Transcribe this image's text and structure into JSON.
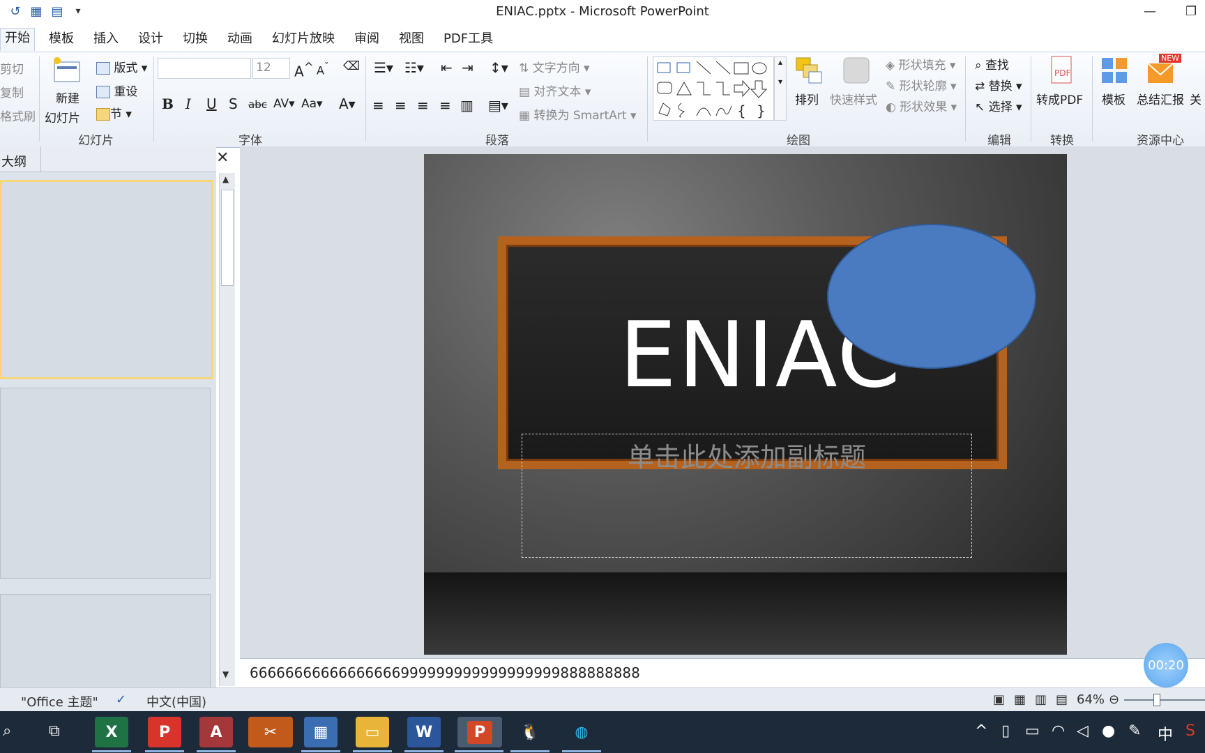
{
  "window": {
    "title": "ENIAC.pptx - Microsoft PowerPoint",
    "minimize_icon": "minimize-icon",
    "maximize_icon": "restore-icon"
  },
  "menu_tabs": [
    "开始",
    "模板",
    "插入",
    "设计",
    "切换",
    "动画",
    "幻灯片放映",
    "审阅",
    "视图",
    "PDF工具"
  ],
  "ribbon": {
    "clipboard": {
      "cut": "剪切",
      "copy": "复制",
      "format_painter": "格式刷"
    },
    "slides": {
      "new_slide_line1": "新建",
      "new_slide_line2": "幻灯片",
      "layout": "版式",
      "reset": "重设",
      "section": "节",
      "group_label": "幻灯片"
    },
    "font": {
      "size": "12",
      "group_label": "字体"
    },
    "paragraph": {
      "text_direction": "文字方向",
      "align_text": "对齐文本",
      "smartart": "转换为 SmartArt",
      "group_label": "段落"
    },
    "drawing": {
      "arrange": "排列",
      "quick_styles": "快速样式",
      "shape_fill": "形状填充",
      "shape_outline": "形状轮廓",
      "shape_effects": "形状效果",
      "group_label": "绘图"
    },
    "editing": {
      "find": "查找",
      "replace": "替换",
      "select": "选择",
      "group_label": "编辑"
    },
    "convert": {
      "to_pdf": "转成PDF",
      "group_label": "转换"
    },
    "resources": {
      "templates": "模板",
      "summary": "总结汇报",
      "more": "关",
      "badge": "NEW",
      "group_label": "资源中心"
    }
  },
  "left_pane": {
    "tab_label": "大纲"
  },
  "slide": {
    "title": "ENIAC",
    "subtitle_placeholder": "单击此处添加副标题"
  },
  "notes": {
    "text": "66666666666666666999999999999999999888888888"
  },
  "timer": {
    "text": "00:20"
  },
  "statusbar": {
    "theme": "\"Office 主题\"",
    "language": "中文(中国)",
    "zoom": "64%"
  },
  "taskbar": {
    "apps": [
      "excel",
      "pdf",
      "access",
      "capcut",
      "calculator",
      "explorer",
      "word",
      "powerpoint",
      "qq",
      "edge"
    ],
    "ime": "中"
  },
  "colors": {
    "accent": "#2a5ea8",
    "ellipse": "#4a7abf",
    "frame": "#b5621f"
  }
}
